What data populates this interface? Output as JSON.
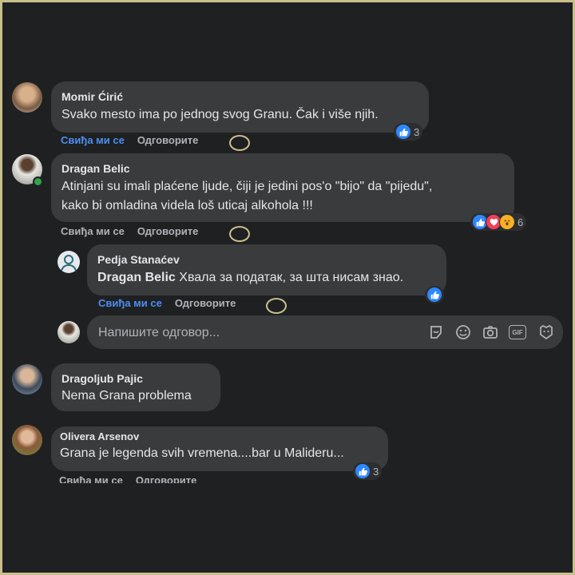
{
  "comments": [
    {
      "author": "Momir Ćirić",
      "text": "Svako mesto ima po jednog svog Granu. Čak i više njih.",
      "like_label": "Свиђа ми се",
      "reply_label": "Одговорите",
      "reaction_count": "3"
    },
    {
      "author": "Dragan Belic",
      "text_line1": "Atinjani su imali plaćene ljude, čiji je jedini pos'o \"bijo\" da \"pijedu\",",
      "text_line2": "kako bi omladina videla loš uticaj alkohola !!!",
      "like_label": "Свиђа ми се",
      "reply_label": "Одговорите",
      "reaction_count": "6"
    },
    {
      "author": "Pedja Stanaćev",
      "mention": "Dragan Belic",
      "text": "Хвала за податак, за шта нисам знао.",
      "like_label": "Свиђа ми се",
      "reply_label": "Одговорите"
    },
    {
      "author": "Dragoljub Pajic",
      "text": "Nema Grana problema"
    },
    {
      "author": "Olivera Arsenov",
      "text": "Grana je legenda svih vremena....bar u Malideru...",
      "like_label": "Свиђа ми се",
      "reply_label": "Одговорите",
      "reaction_count": "3"
    }
  ],
  "reply_box": {
    "placeholder": "Напишите одговор...",
    "icons": [
      "sticker-icon",
      "emoji-icon",
      "camera-icon",
      "gif-icon",
      "avatar-sticker-icon"
    ],
    "gif_label": "GIF"
  },
  "colors": {
    "background": "#1f2022",
    "bubble": "#3a3b3c",
    "like_blue": "#4c8ff0",
    "text": "#e4e6eb",
    "muted": "#b0b3b8",
    "frame": "#c9bf8c"
  }
}
